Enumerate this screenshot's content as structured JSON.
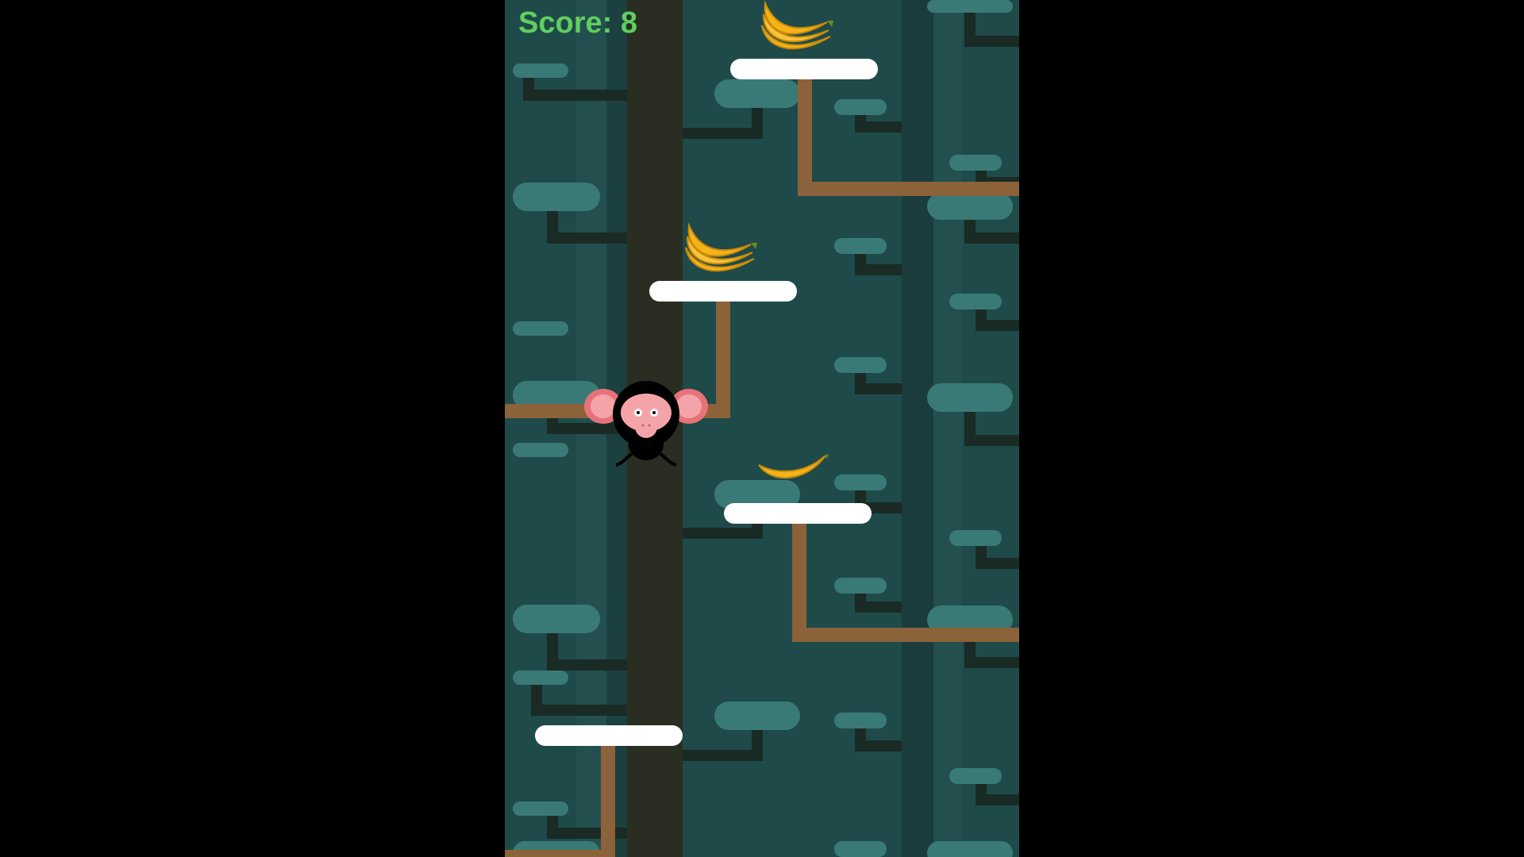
{
  "game": {
    "score_label": "Score:",
    "score_value": 8
  },
  "items": {
    "player": "monkey",
    "collectibles": [
      "banana-bunch",
      "banana-bunch",
      "banana"
    ],
    "platform_count": 4
  },
  "colors": {
    "background": "#1f4a4a",
    "platform": "#ffffff",
    "branch": "#8b6239",
    "score": "#5fcf5f",
    "banana": "#f4b41a",
    "monkey_face": "#f4a4a8"
  }
}
